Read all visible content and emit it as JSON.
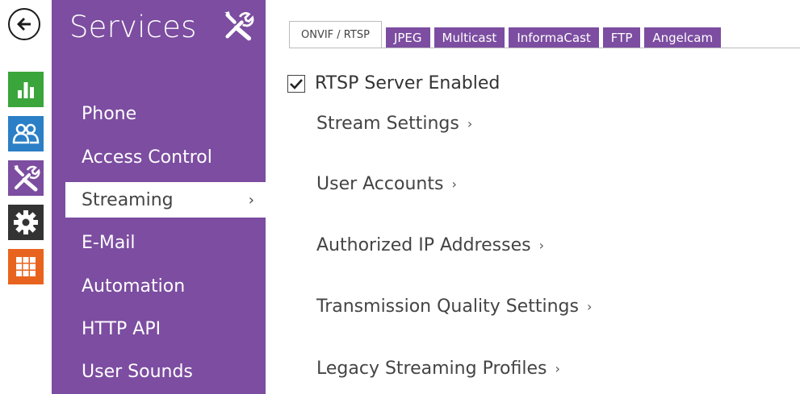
{
  "rail": {
    "items": [
      {
        "icon": "back-arrow-icon",
        "color": "#1a1a1a"
      },
      {
        "icon": "bar-chart-icon",
        "color": "#3aa53a"
      },
      {
        "icon": "users-icon",
        "color": "#2b7fc6"
      },
      {
        "icon": "tools-icon",
        "color": "#7c4da0"
      },
      {
        "icon": "gear-icon",
        "color": "#333333"
      },
      {
        "icon": "grid-icon",
        "color": "#e8641e"
      }
    ]
  },
  "menu": {
    "title": "Services",
    "title_icon": "tools-icon",
    "items": [
      {
        "label": "Phone",
        "active": false
      },
      {
        "label": "Access Control",
        "active": false
      },
      {
        "label": "Streaming",
        "active": true,
        "chevron": "›"
      },
      {
        "label": "E-Mail",
        "active": false
      },
      {
        "label": "Automation",
        "active": false
      },
      {
        "label": "HTTP API",
        "active": false
      },
      {
        "label": "User Sounds",
        "active": false
      }
    ]
  },
  "tabs": [
    {
      "label": "ONVIF / RTSP",
      "active": true
    },
    {
      "label": "JPEG",
      "active": false
    },
    {
      "label": "Multicast",
      "active": false
    },
    {
      "label": "InformaCast",
      "active": false
    },
    {
      "label": "FTP",
      "active": false
    },
    {
      "label": "Angelcam",
      "active": false
    }
  ],
  "content": {
    "rtsp_enabled_label": "RTSP Server Enabled",
    "rtsp_enabled_checked": true,
    "links": [
      {
        "label": "Stream Settings",
        "arrow": "›"
      },
      {
        "label": "User Accounts",
        "arrow": "›"
      },
      {
        "label": "Authorized IP Addresses",
        "arrow": "›"
      },
      {
        "label": "Transmission Quality Settings",
        "arrow": "›"
      },
      {
        "label": "Legacy Streaming Profiles",
        "arrow": "›"
      }
    ]
  },
  "colors": {
    "accent": "#7c4da0",
    "background": "#ffffff"
  }
}
